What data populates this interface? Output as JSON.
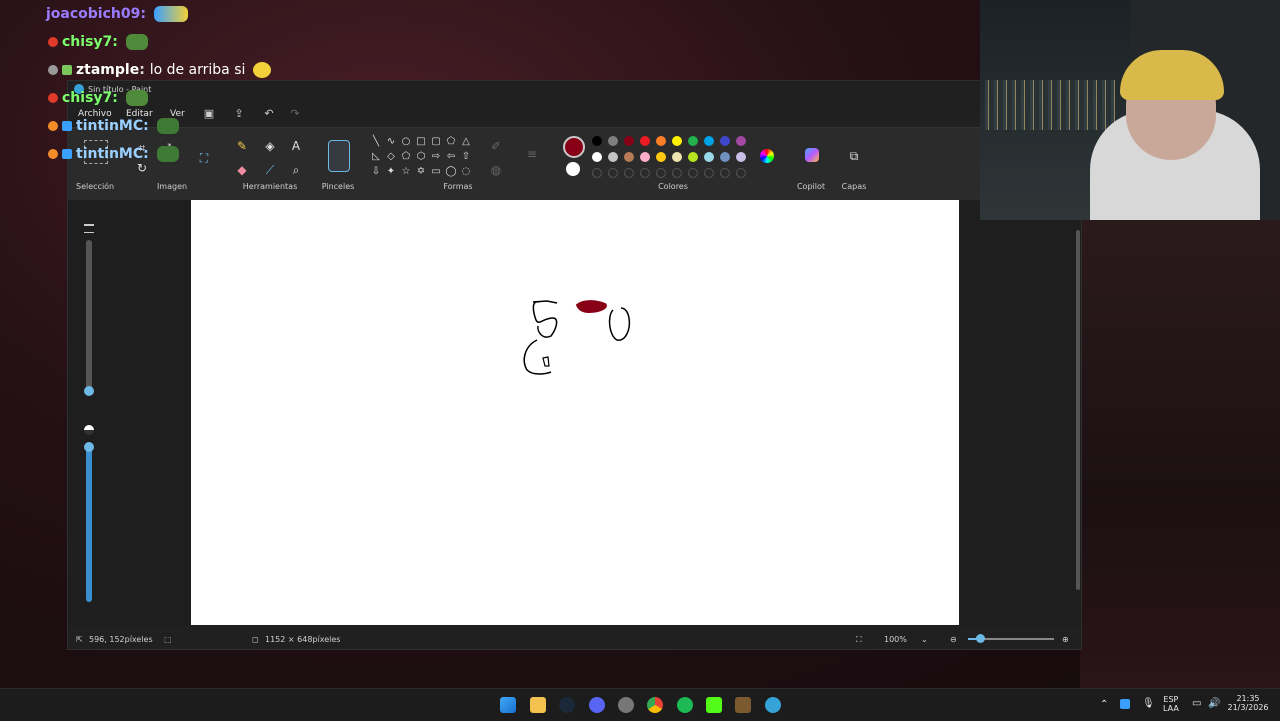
{
  "chat": [
    {
      "user": "joacobich09",
      "color": "#9b7cff",
      "msg": ""
    },
    {
      "user": "chisy7",
      "color": "#7cff6b",
      "msg": ""
    },
    {
      "user": "ztample",
      "color": "#ffffff",
      "msg": "lo de arriba si"
    },
    {
      "user": "chisy7",
      "color": "#7cff6b",
      "msg": ""
    },
    {
      "user": "tintinMC",
      "color": "#9ad0ff",
      "msg": ""
    },
    {
      "user": "tintinMC",
      "color": "#9ad0ff",
      "msg": ""
    }
  ],
  "window": {
    "title": "Sin título - Paint"
  },
  "menu": {
    "file": "Archivo",
    "edit": "Editar",
    "view": "Ver"
  },
  "groups": {
    "selection": "Selección",
    "image": "Imagen",
    "tools": "Herramientas",
    "brushes": "Pinceles",
    "shapes": "Formas",
    "colors": "Colores",
    "copilot": "Copilot",
    "layers": "Capas"
  },
  "colors": {
    "primary": "#880015",
    "secondary": "#ffffff",
    "row1": [
      "#000000",
      "#7f7f7f",
      "#880015",
      "#ed1c24",
      "#ff7f27",
      "#fff200",
      "#22b14c",
      "#00a2e8",
      "#3f48cc",
      "#a349a4"
    ],
    "row2": [
      "#ffffff",
      "#c3c3c3",
      "#b97a57",
      "#ffaec9",
      "#ffc90e",
      "#efe4b0",
      "#b5e61d",
      "#99d9ea",
      "#7092be",
      "#c8bfe7"
    ]
  },
  "status": {
    "cursor": "596, 152píxeles",
    "canvas_size": "1152 × 648píxeles",
    "zoom": "100%"
  },
  "tray": {
    "lang1": "ESP",
    "lang2": "LAA",
    "time": "21:35",
    "date": "21/3/2026"
  }
}
